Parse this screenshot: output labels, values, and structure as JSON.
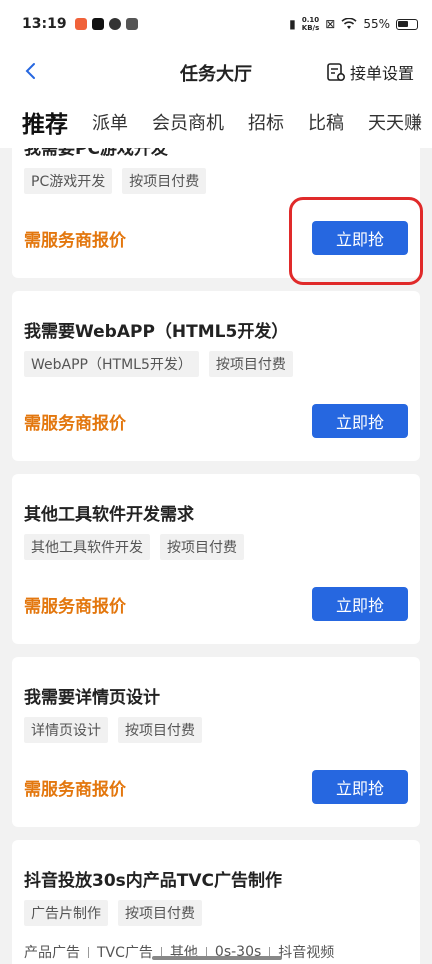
{
  "status": {
    "time": "13:19",
    "net_speed_value": "0.10",
    "net_speed_unit": "KB/s",
    "battery": "55%",
    "app_colors": [
      "#f0623a",
      "#111111",
      "#333333",
      "#555555"
    ]
  },
  "nav": {
    "title": "任务大厅",
    "action_label": "接单设置"
  },
  "tabs": [
    "推荐",
    "派单",
    "会员商机",
    "招标",
    "比稿",
    "天天赚"
  ],
  "accent_colors": {
    "price": "#e3770e",
    "button": "#2667e0",
    "highlight": "#e02a2a"
  },
  "cards": [
    {
      "title": "我需要PC游戏开发",
      "tags": [
        "PC游戏开发",
        "按项目付费"
      ],
      "price": "需服务商报价",
      "button": "立即抢"
    },
    {
      "title": "我需要WebAPP（HTML5开发）",
      "tags": [
        "WebAPP（HTML5开发）",
        "按项目付费"
      ],
      "price": "需服务商报价",
      "button": "立即抢"
    },
    {
      "title": "其他工具软件开发需求",
      "tags": [
        "其他工具软件开发",
        "按项目付费"
      ],
      "price": "需服务商报价",
      "button": "立即抢"
    },
    {
      "title": "我需要详情页设计",
      "tags": [
        "详情页设计",
        "按项目付费"
      ],
      "price": "需服务商报价",
      "button": "立即抢"
    },
    {
      "title": "抖音投放30s内产品TVC广告制作",
      "tags": [
        "广告片制作",
        "按项目付费"
      ],
      "meta": [
        "产品广告",
        "TVC广告",
        "其他",
        "0s-30s",
        "抖音视频"
      ]
    }
  ]
}
